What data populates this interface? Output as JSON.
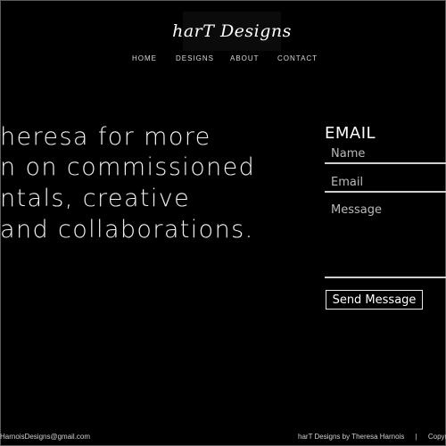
{
  "logo": {
    "text": "harT Designs"
  },
  "nav": {
    "items": [
      {
        "label": "HOME"
      },
      {
        "label": "DESIGNS"
      },
      {
        "label": "ABOUT"
      },
      {
        "label": "CONTACT"
      }
    ]
  },
  "hero": {
    "lines": [
      "heresa for more",
      "n on commissioned",
      "ntals, creative",
      "and collaborations."
    ]
  },
  "contact_form": {
    "title": "EMAIL",
    "name_placeholder": "Name",
    "email_placeholder": "Email",
    "message_placeholder": "Message",
    "submit_label": "Send Message"
  },
  "footer": {
    "email": "HarnoisDesigns@gmail.com",
    "credit": "harT Designs by Theresa Harnois",
    "separator": "|",
    "copyright": "Copyright"
  }
}
